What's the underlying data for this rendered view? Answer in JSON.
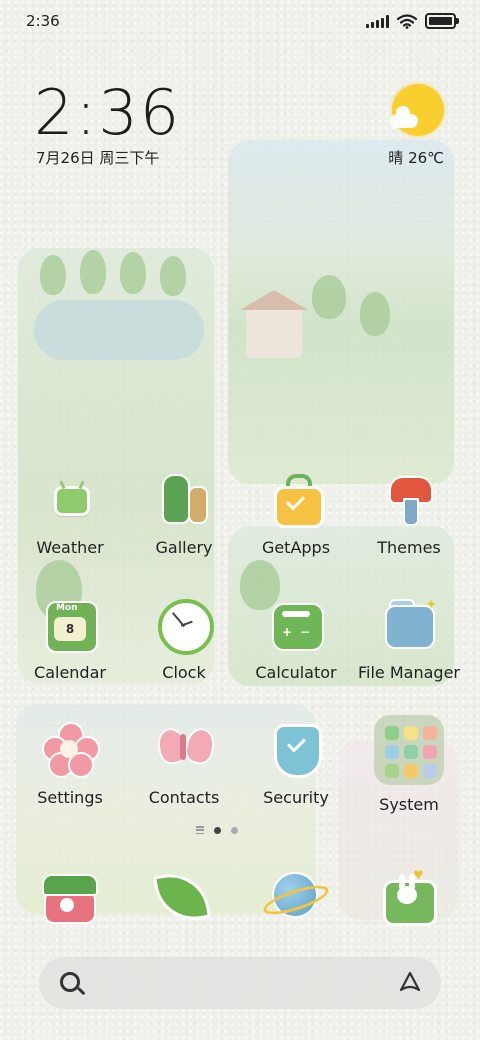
{
  "status_bar": {
    "time": "2:36"
  },
  "clock_widget": {
    "time": "2:36",
    "date": "7月26日 周三下午"
  },
  "weather_widget": {
    "text": "晴 26℃"
  },
  "apps": {
    "weather": "Weather",
    "gallery": "Gallery",
    "getapps": "GetApps",
    "themes": "Themes",
    "calendar": "Calendar",
    "calendar_day": "8",
    "calendar_month": "Mon",
    "clock": "Clock",
    "calculator": "Calculator",
    "file_manager": "File Manager",
    "settings": "Settings",
    "contacts": "Contacts",
    "security": "Security",
    "system": "System"
  },
  "pager": {
    "pages": 2,
    "active_page": 1
  },
  "colors": {
    "accent_green": "#6fb657",
    "sun": "#f8cf2f"
  }
}
